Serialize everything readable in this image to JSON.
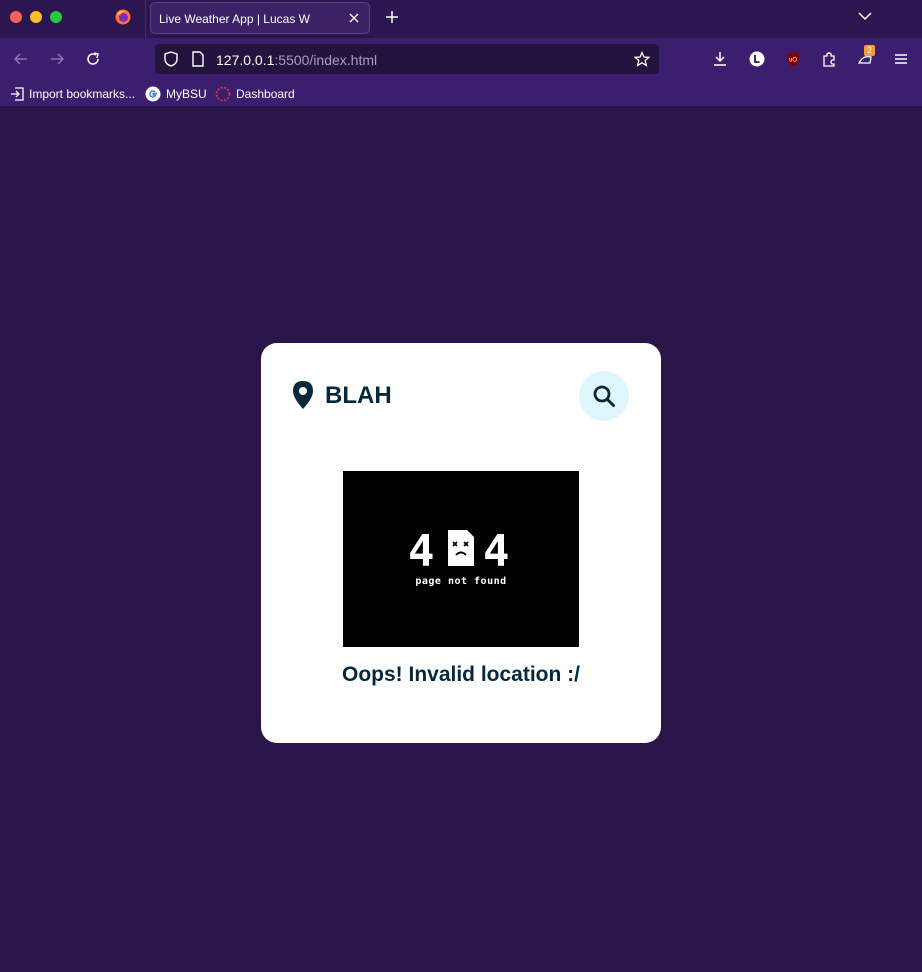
{
  "browser": {
    "tab": {
      "title": "Live Weather App | Lucas W"
    },
    "url": {
      "host": "127.0.0.1",
      "rest": ":5500/index.html"
    },
    "extension_badge": "2",
    "bookmarks": [
      {
        "label": "Import bookmarks..."
      },
      {
        "label": "MyBSU"
      },
      {
        "label": "Dashboard"
      }
    ]
  },
  "app": {
    "search": {
      "value": "BLAH"
    },
    "not_found_image": {
      "digit_left": "4",
      "digit_right": "4",
      "caption": "page not found"
    },
    "error_message": "Oops! Invalid location :/"
  },
  "colors": {
    "page_background": "#2a1548",
    "card_background": "#ffffff",
    "text_primary": "#06283d",
    "search_button_bg": "#dff6ff"
  }
}
